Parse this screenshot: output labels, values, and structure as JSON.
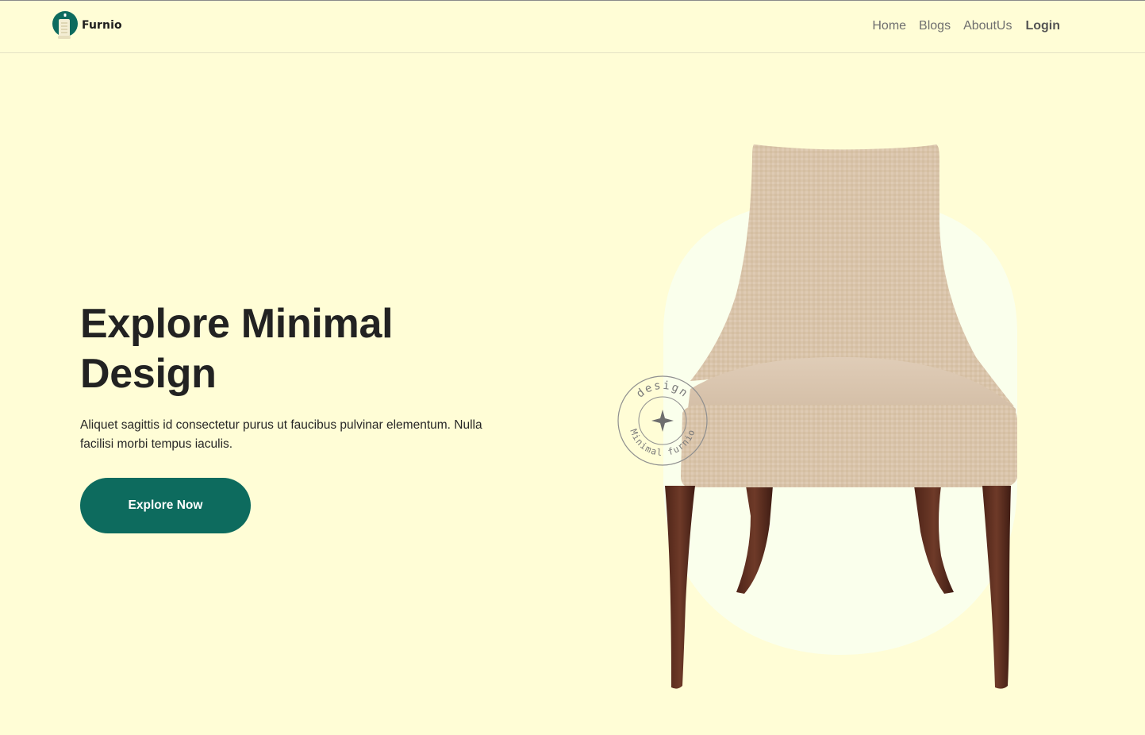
{
  "brand": {
    "name": "Furnio",
    "logo_icon": "lamp-logo-icon",
    "accent_color": "#0D6B5E"
  },
  "nav": {
    "links": [
      "Home",
      "Blogs",
      "AboutUs",
      "Login"
    ]
  },
  "hero": {
    "title_line1": "Explore Minimal",
    "title_line2": "Design",
    "description": "Aliquet sagittis id consectetur purus ut faucibus pulvinar elementum. Nulla facilisi morbi tempus iaculis.",
    "cta_label": "Explore Now",
    "background_color": "#FFFDD6",
    "stamp": {
      "top_text": "design",
      "bottom_text": "Minimal furnio"
    }
  }
}
